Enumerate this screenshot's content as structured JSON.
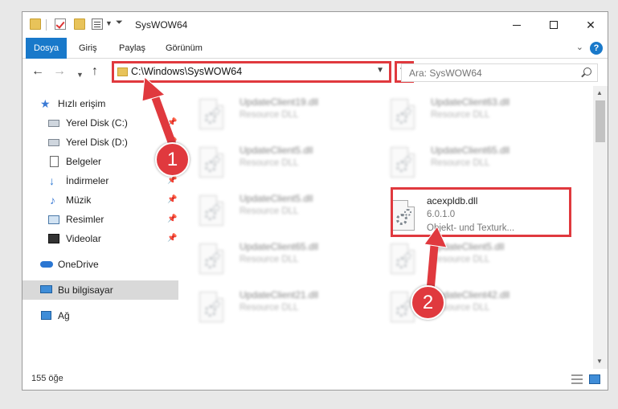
{
  "window": {
    "title": "SysWOW64",
    "controls": {
      "minimize": "minimize",
      "maximize": "maximize",
      "close": "✕"
    }
  },
  "ribbon": {
    "tabs": [
      {
        "label": "Dosya",
        "active": true
      },
      {
        "label": "Giriş",
        "active": false
      },
      {
        "label": "Paylaş",
        "active": false
      },
      {
        "label": "Görünüm",
        "active": false
      }
    ],
    "help": "?"
  },
  "nav": {
    "address_path": "C:\\Windows\\SysWOW64",
    "search_placeholder": "Ara: SysWOW64"
  },
  "sidebar": {
    "items": [
      {
        "label": "Hızlı erişim",
        "icon": "star-icon"
      },
      {
        "label": "Yerel Disk (C:)",
        "icon": "disk-icon",
        "pinned": true
      },
      {
        "label": "Yerel Disk (D:)",
        "icon": "disk-icon",
        "pinned": true
      },
      {
        "label": "Belgeler",
        "icon": "documents-icon",
        "pinned": true
      },
      {
        "label": "İndirmeler",
        "icon": "download-icon",
        "pinned": true
      },
      {
        "label": "Müzik",
        "icon": "music-icon",
        "pinned": true
      },
      {
        "label": "Resimler",
        "icon": "pictures-icon",
        "pinned": true
      },
      {
        "label": "Videolar",
        "icon": "video-icon",
        "pinned": true
      },
      {
        "label": "OneDrive",
        "icon": "cloud-icon"
      },
      {
        "label": "Bu bilgisayar",
        "icon": "computer-icon",
        "selected": true
      },
      {
        "label": "Ağ",
        "icon": "network-icon"
      }
    ]
  },
  "files": [
    {
      "name": "UpdateClient19.dll",
      "type": "Resource DLL",
      "blurred": true
    },
    {
      "name": "UpdateClient63.dll",
      "type": "Resource DLL",
      "blurred": true
    },
    {
      "name": "UpdateClient5.dll",
      "type": "Resource DLL",
      "blurred": true
    },
    {
      "name": "UpdateClient65.dll",
      "type": "Resource DLL",
      "blurred": true
    },
    {
      "name": "UpdateClient5.dll",
      "type": "Resource DLL",
      "blurred": true
    },
    {
      "name": "acexpldb.dll",
      "version": "6.0.1.0",
      "type": "Objekt- und Texturk...",
      "blurred": false
    },
    {
      "name": "UpdateClient65.dll",
      "type": "Resource DLL",
      "blurred": true
    },
    {
      "name": "UpdateClient5.dll",
      "type": "Resource DLL",
      "blurred": true
    },
    {
      "name": "UpdateClient21.dll",
      "type": "Resource DLL",
      "blurred": true
    },
    {
      "name": "UpdateClient42.dll",
      "type": "Resource DLL",
      "blurred": true
    }
  ],
  "status": {
    "item_count": "155 öğe"
  },
  "annotations": {
    "step1": "1",
    "step2": "2",
    "color": "#e0393e"
  }
}
